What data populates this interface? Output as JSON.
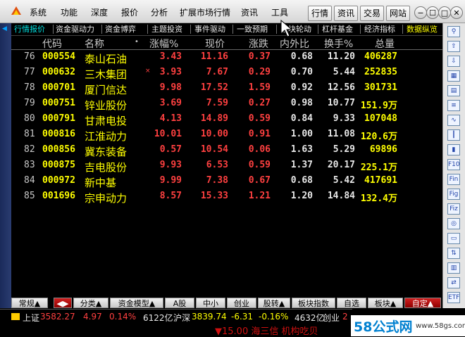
{
  "menubar": {
    "items": [
      "系统",
      "功能",
      "深度",
      "报价",
      "分析",
      "扩展市场行情",
      "资讯",
      "工具"
    ],
    "buttons": [
      "行情",
      "资讯",
      "交易",
      "网站"
    ],
    "window_controls": [
      "−",
      "☐",
      "□",
      "✕"
    ]
  },
  "top_tabs": [
    "行情报价",
    "资金驱动力",
    "资金博弈",
    "主题投资",
    "事件驱动",
    "一致预期",
    "板块轮动",
    "杠杆基金",
    "经济指标",
    "数据纵览"
  ],
  "table": {
    "headers": [
      "代码",
      "名称",
      "•",
      "涨幅%",
      "现价",
      "涨跌",
      "内外比",
      "换手%",
      "总量"
    ],
    "rows": [
      {
        "idx": "76",
        "code": "000554",
        "name": "泰山石油",
        "mark": "",
        "chg_pct": "3.43",
        "price": "11.16",
        "chg": "0.37",
        "ratio": "0.68",
        "turnover": "11.20",
        "volume": "406287"
      },
      {
        "idx": "77",
        "code": "000632",
        "name": "三木集团",
        "mark": "×",
        "chg_pct": "3.93",
        "price": "7.67",
        "chg": "0.29",
        "ratio": "0.70",
        "turnover": "5.44",
        "volume": "252835"
      },
      {
        "idx": "78",
        "code": "000701",
        "name": "厦门信达",
        "mark": "",
        "chg_pct": "9.98",
        "price": "17.52",
        "chg": "1.59",
        "ratio": "0.92",
        "turnover": "12.56",
        "volume": "301731"
      },
      {
        "idx": "79",
        "code": "000751",
        "name": "锌业股份",
        "mark": "",
        "chg_pct": "3.69",
        "price": "7.59",
        "chg": "0.27",
        "ratio": "0.98",
        "turnover": "10.77",
        "volume": "151.9万"
      },
      {
        "idx": "80",
        "code": "000791",
        "name": "甘肃电投",
        "mark": "",
        "chg_pct": "4.13",
        "price": "14.89",
        "chg": "0.59",
        "ratio": "0.84",
        "turnover": "9.33",
        "volume": "107048"
      },
      {
        "idx": "81",
        "code": "000816",
        "name": "江淮动力",
        "mark": "",
        "chg_pct": "10.01",
        "price": "10.00",
        "chg": "0.91",
        "ratio": "1.00",
        "turnover": "11.08",
        "volume": "120.6万"
      },
      {
        "idx": "82",
        "code": "000856",
        "name": "冀东装备",
        "mark": "",
        "chg_pct": "0.57",
        "price": "10.54",
        "chg": "0.06",
        "ratio": "1.63",
        "turnover": "5.29",
        "volume": "69896"
      },
      {
        "idx": "83",
        "code": "000875",
        "name": "吉电股份",
        "mark": "",
        "chg_pct": "9.93",
        "price": "6.53",
        "chg": "0.59",
        "ratio": "1.37",
        "turnover": "20.17",
        "volume": "225.1万"
      },
      {
        "idx": "84",
        "code": "000972",
        "name": "新中基",
        "mark": "",
        "chg_pct": "9.99",
        "price": "7.38",
        "chg": "0.67",
        "ratio": "0.68",
        "turnover": "5.42",
        "volume": "417691"
      },
      {
        "idx": "85",
        "code": "001696",
        "name": "宗申动力",
        "mark": "",
        "chg_pct": "8.57",
        "price": "15.33",
        "chg": "1.21",
        "ratio": "1.20",
        "turnover": "14.84",
        "volume": "132.4万"
      }
    ]
  },
  "bottom_tabs": [
    "常规▲",
    "◀▶",
    "分类▲",
    "资金模型▲",
    "A股",
    "中小",
    "创业",
    "股转▲",
    "板块指数",
    "自选",
    "板块▲",
    "自定▲"
  ],
  "status": {
    "sh_label": "上证",
    "sh_value": "3582.27",
    "sh_chg": "4.97",
    "sh_pct": "0.14%",
    "sh_amount": "6122亿",
    "sz_label": "沪深",
    "sz_value": "3839.74",
    "sz_chg": "-6.31",
    "sz_pct": "-0.16%",
    "sz_amount": "4632亿",
    "cy_label": "创业",
    "cy_value": "2"
  },
  "ticker": "▼15.00  海三信  机构吃贝",
  "watermark": {
    "big": "58公式网",
    "small": "www.58gs.com"
  },
  "colors": {
    "up": "#ff4040",
    "code": "#ffff00",
    "flat": "#e8e8e8",
    "active_tab": "#00e0e0"
  },
  "right_toolbar_icons": [
    "pin-icon",
    "up-arrow-icon",
    "down-arrow-icon",
    "grid-icon",
    "table-icon",
    "list-icon",
    "line-chart-icon",
    "kline-icon",
    "volume-icon",
    "f10-icon",
    "fin-icon",
    "fig-icon",
    "fiz-icon",
    "option-icon",
    "folder-icon",
    "sort-icon",
    "bars-icon",
    "exchange-icon",
    "etf-icon"
  ]
}
